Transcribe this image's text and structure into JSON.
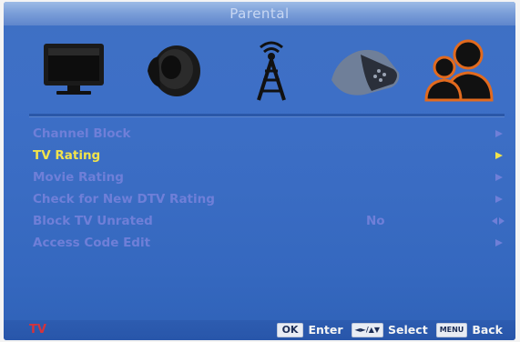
{
  "title": "Parental",
  "tabs": [
    {
      "name": "picture",
      "icon": "tv-icon"
    },
    {
      "name": "sound",
      "icon": "speaker-icon"
    },
    {
      "name": "channel",
      "icon": "antenna-icon"
    },
    {
      "name": "setup",
      "icon": "hand-remote-icon"
    },
    {
      "name": "parental",
      "icon": "users-icon",
      "selected": true
    }
  ],
  "menu": [
    {
      "label": "Channel Block",
      "value": "",
      "control": "arrow"
    },
    {
      "label": "TV Rating",
      "value": "",
      "control": "arrow",
      "active": true
    },
    {
      "label": "Movie Rating",
      "value": "",
      "control": "arrow"
    },
    {
      "label": "Check for New DTV Rating",
      "value": "",
      "control": "arrow"
    },
    {
      "label": "Block TV Unrated",
      "value": "No",
      "control": "left-right"
    },
    {
      "label": "Access Code Edit",
      "value": "",
      "control": "arrow"
    }
  ],
  "footer": {
    "source": "TV",
    "ok_key": "OK",
    "enter_label": "Enter",
    "select_key": "◄►/▲▼",
    "select_label": "Select",
    "menu_key": "MENU",
    "back_label": "Back"
  },
  "colors": {
    "selected_text": "#f1e34b",
    "normal_text": "#6f7fd8",
    "source_text": "#d6333b",
    "panel_bg": "#3d6fc6"
  }
}
